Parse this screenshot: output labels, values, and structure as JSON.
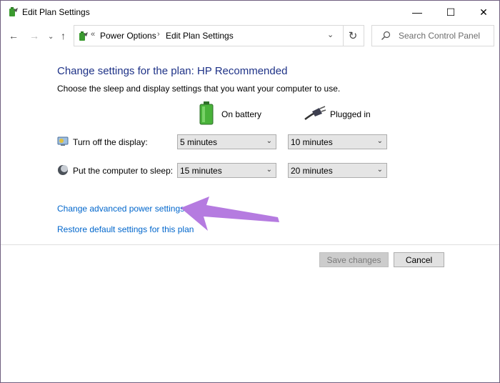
{
  "window": {
    "title": "Edit Plan Settings",
    "controls": {
      "minimize": "—",
      "maximize": "☐",
      "close": "✕"
    }
  },
  "nav": {
    "back": "←",
    "forward": "→",
    "recent": "⌄",
    "up": "↑",
    "breadcrumb_overflow": "«",
    "breadcrumbs": [
      "Power Options",
      "Edit Plan Settings"
    ],
    "separator": "›",
    "dropdown": "⌄",
    "refresh": "↻",
    "search_placeholder": "Search Control Panel"
  },
  "main": {
    "heading": "Change settings for the plan: HP Recommended",
    "subheading": "Choose the sleep and display settings that you want your computer to use.",
    "columns": {
      "battery": "On battery",
      "plugged": "Plugged in"
    },
    "rows": [
      {
        "label": "Turn off the display:",
        "battery": "5 minutes",
        "plugged": "10 minutes"
      },
      {
        "label": "Put the computer to sleep:",
        "battery": "15 minutes",
        "plugged": "20 minutes"
      }
    ],
    "links": {
      "advanced": "Change advanced power settings",
      "restore": "Restore default settings for this plan"
    },
    "annotation_arrow_color": "#b57be0"
  },
  "footer": {
    "save": "Save changes",
    "cancel": "Cancel"
  },
  "icons": {
    "title": "power-plan-icon",
    "battery": "battery-icon",
    "plug": "plug-icon",
    "display": "display-icon",
    "sleep": "sleep-icon",
    "search": "search-icon"
  }
}
